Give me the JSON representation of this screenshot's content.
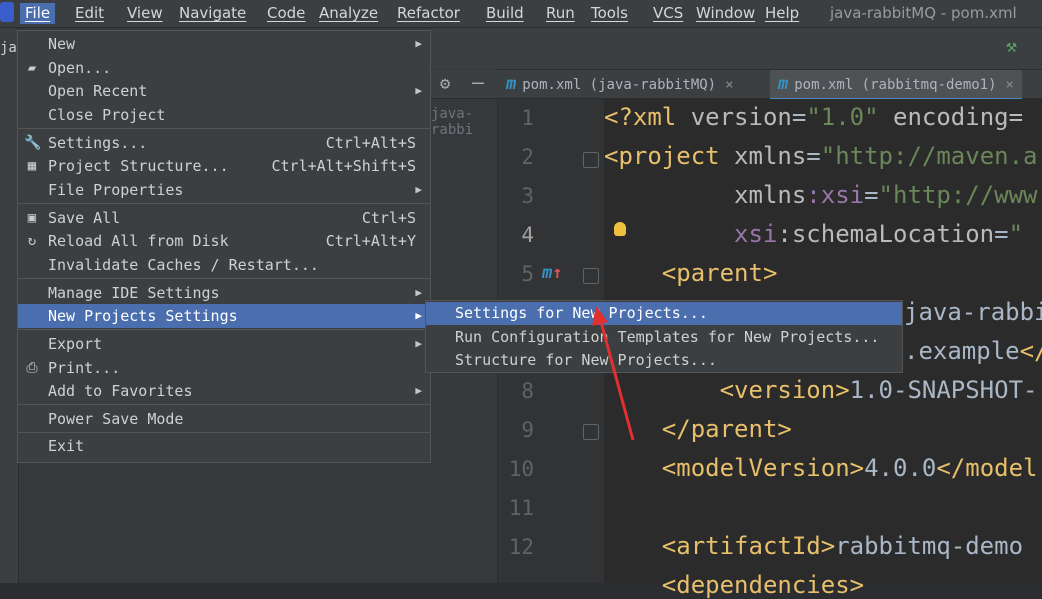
{
  "window_title": "java-rabbitMQ - pom.xml",
  "menubar": [
    "File",
    "Edit",
    "View",
    "Navigate",
    "Code",
    "Analyze",
    "Refactor",
    "Build",
    "Run",
    "Tools",
    "VCS",
    "Window",
    "Help"
  ],
  "project_ghost": "java-rabbi",
  "left_label": "jav",
  "tabs": [
    {
      "icon": "m",
      "label": "pom.xml (java-rabbitMQ)",
      "close": "×"
    },
    {
      "icon": "m",
      "label": "pom.xml (rabbitmq-demo1)",
      "close": "×"
    }
  ],
  "file_menu": {
    "new": "New",
    "open": "Open...",
    "open_recent": "Open Recent",
    "close_project": "Close Project",
    "settings": "Settings...",
    "settings_sc": "Ctrl+Alt+S",
    "project_structure": "Project Structure...",
    "project_structure_sc": "Ctrl+Alt+Shift+S",
    "file_properties": "File Properties",
    "save_all": "Save All",
    "save_all_sc": "Ctrl+S",
    "reload_all": "Reload All from Disk",
    "reload_all_sc": "Ctrl+Alt+Y",
    "invalidate": "Invalidate Caches / Restart...",
    "manage_ide": "Manage IDE Settings",
    "new_projects_settings": "New Projects Settings",
    "export": "Export",
    "print": "Print...",
    "add_favorites": "Add to Favorites",
    "power_save": "Power Save Mode",
    "exit": "Exit"
  },
  "submenu": {
    "settings_new": "Settings for New Projects...",
    "run_config": "Run Configuration Templates for New Projects...",
    "structure_new": "Structure for New Projects..."
  },
  "line_numbers": [
    "1",
    "2",
    "3",
    "4",
    "5",
    "6",
    "7",
    "8",
    "9",
    "10",
    "11",
    "12"
  ],
  "code": {
    "l1a": "<?xml ",
    "l1b": "version",
    "l1c": "=",
    "l1d": "\"1.0\"",
    "l1e": " encoding=",
    "l2a": "<project ",
    "l2b": "xmlns",
    "l2c": "=",
    "l2d": "\"http://maven.a",
    "l3a": "         xmlns",
    "l3b": ":xsi",
    "l3c": "=",
    "l3d": "\"http://www",
    "l4a": "         xsi",
    "l4b": ":schemaLocation",
    "l4c": "=",
    "l4d": "\"",
    "l5": "    <parent>",
    "l6": "java-rabbi",
    "l7a": ".example",
    "l7b": "</",
    "l8a": "        <version>",
    "l8b": "1.0-SNAPSHOT-",
    "l9": "    </parent>",
    "l10a": "    <modelVersion>",
    "l10b": "4.0.0",
    "l10c": "</model",
    "l12a": "    <artifactId>",
    "l12b": "rabbitmq-demo",
    "l13": "    <dependencies>"
  }
}
